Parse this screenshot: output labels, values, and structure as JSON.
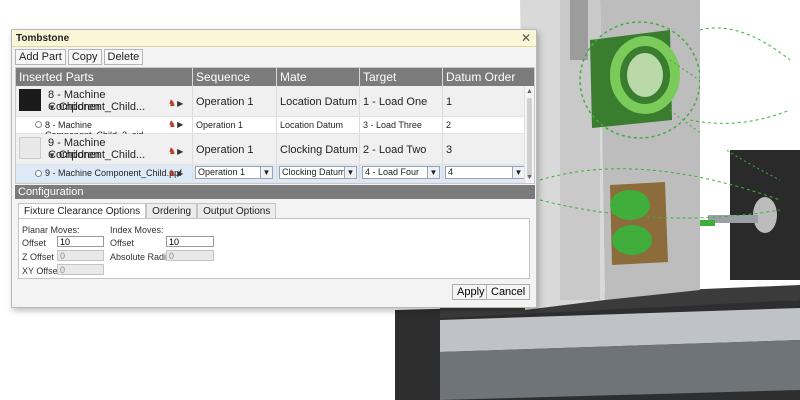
{
  "colors": {
    "title_bar": "#fbf6d8",
    "header_bg": "#7b7b7b",
    "selected_row": "#dde9f7",
    "fixture_green": "#3fae3a"
  },
  "dialog": {
    "title": "Tombstone",
    "close_icon": "close-icon",
    "toolbar": {
      "add_part": "Add Part",
      "copy": "Copy",
      "delete": "Delete"
    },
    "grid": {
      "headers": [
        "Inserted Parts",
        "Sequence",
        "Mate",
        "Target",
        "Datum Order"
      ],
      "rows": [
        {
          "kind": "parent",
          "name": "8 - Machine Component_Child...",
          "children_label": "Children",
          "sequence": "Operation 1",
          "mate": "Location Datum",
          "target": "1 - Load One",
          "datum_order": "1"
        },
        {
          "kind": "child",
          "name": "8 - Machine Component_Child_3_sid...",
          "sequence": "Operation 1",
          "mate": "Location Datum",
          "target": "3 - Load Three",
          "datum_order": "2"
        },
        {
          "kind": "parent",
          "name": "9 - Machine Component_Child...",
          "children_label": "Children",
          "sequence": "Operation 1",
          "mate": "Clocking Datum",
          "target": "2 - Load Two",
          "datum_order": "3"
        },
        {
          "kind": "child-selected",
          "name": "9 - Machine Component_Child.ppf",
          "sequence": "Operation 1",
          "mate": "Clocking Datum",
          "target": "4 - Load Four",
          "datum_order": "4"
        }
      ]
    },
    "configuration": {
      "title": "Configuration",
      "tabs": [
        "Fixture Clearance Options",
        "Ordering",
        "Output Options"
      ],
      "active_tab": "Fixture Clearance Options",
      "planar_moves_label": "Planar Moves:",
      "index_moves_label": "Index Moves:",
      "planar_offset_label": "Offset",
      "planar_offset_value": "10",
      "z_offset_label": "Z Offset",
      "z_offset_value": "0",
      "xy_offset_label": "XY Offset",
      "xy_offset_value": "0",
      "index_offset_label": "Offset",
      "index_offset_value": "10",
      "absolute_radius_label": "Absolute Radius",
      "absolute_radius_value": "0"
    },
    "actions": {
      "apply": "Apply",
      "cancel": "Cancel"
    }
  }
}
